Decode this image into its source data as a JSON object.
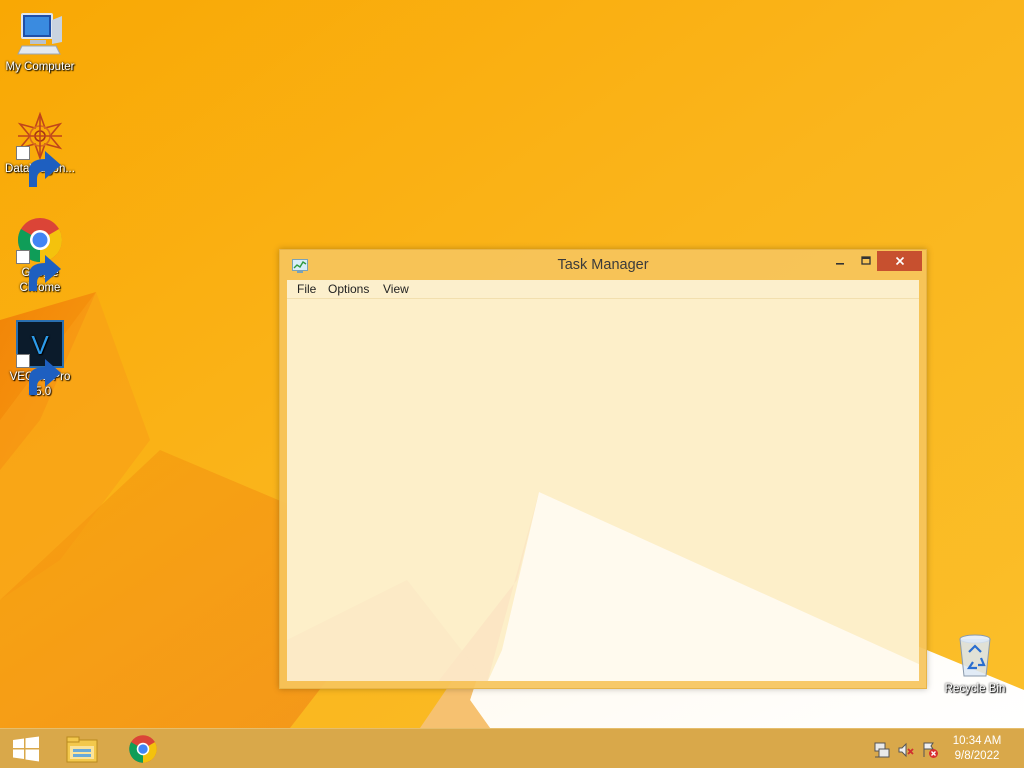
{
  "desktop": {
    "icons": [
      {
        "label": "My Computer",
        "icon": "computer-icon"
      },
      {
        "label": "DataWagon...",
        "icon": "datawagon-icon"
      },
      {
        "label": "Google Chrome",
        "icon": "chrome-icon"
      },
      {
        "label": "VEGAS Pro 15.0",
        "icon": "vegas-icon"
      },
      {
        "label": "Recycle Bin",
        "icon": "recycle-bin-icon"
      }
    ],
    "vegas_letter": "V"
  },
  "window": {
    "title": "Task Manager",
    "menu": [
      "File",
      "Options",
      "View"
    ],
    "accent": "#c7502f"
  },
  "taskbar": {
    "pinned": [
      "start-button",
      "file-explorer-icon",
      "chrome-icon"
    ],
    "tray": [
      "network-icon",
      "volume-muted-icon",
      "action-center-icon"
    ],
    "time": "10:34 AM",
    "date": "9/8/2022"
  }
}
